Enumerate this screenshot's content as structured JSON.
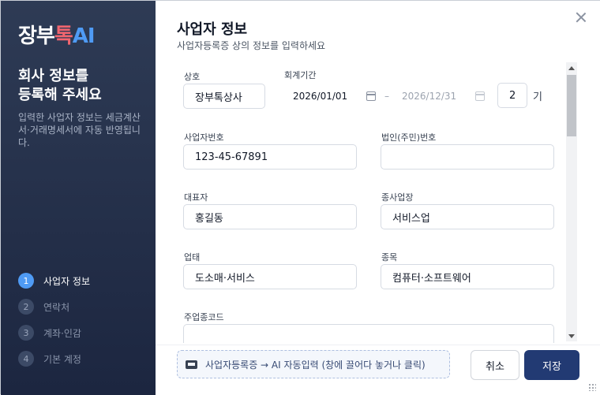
{
  "app": {
    "logo_part1": "장부",
    "logo_part2": "톡",
    "logo_part3": "AI"
  },
  "sidebar": {
    "title_line1": "회사 정보를",
    "title_line2": "등록해 주세요",
    "description": "입력한 사업자 정보는 세금계산서·거래명세서에 자동 반영됩니다.",
    "steps": [
      {
        "num": "1",
        "label": "사업자 정보",
        "active": true
      },
      {
        "num": "2",
        "label": "연락처",
        "active": false
      },
      {
        "num": "3",
        "label": "계좌·인감",
        "active": false
      },
      {
        "num": "4",
        "label": "기본 계정",
        "active": false
      }
    ]
  },
  "main": {
    "title": "사업자 정보",
    "subtitle": "사업자등록증 상의 정보를 입력하세요",
    "fields": {
      "company_name": {
        "label": "상호",
        "value": "장부톡상사"
      },
      "fiscal_period": {
        "label": "회계기간",
        "start": "2026/01/01",
        "separator": "–",
        "end": "2026/12/31",
        "term": "2",
        "term_unit": "기"
      },
      "business_number": {
        "label": "사업자번호",
        "value": "123-45-67891"
      },
      "corp_number": {
        "label": "법인(주민)번호",
        "value": ""
      },
      "representative": {
        "label": "대표자",
        "value": "홍길동"
      },
      "workplace": {
        "label": "종사업장",
        "value": "서비스업"
      },
      "business_type": {
        "label": "업태",
        "value": "도소매·서비스"
      },
      "business_item": {
        "label": "종목",
        "value": "컴퓨터·소프트웨어"
      },
      "main_industry_code": {
        "label": "주업종코드",
        "value": ""
      }
    }
  },
  "footer": {
    "ai_drop_text": "사업자등록증 → AI 자동입력 (창에 끌어다 놓거나 클릭)",
    "cancel_label": "취소",
    "save_label": "저장"
  },
  "colors": {
    "sidebar_bg": "#2e3b55",
    "accent_blue": "#4f9bf5",
    "logo_red": "#f1656f",
    "save_button": "#223a73"
  }
}
